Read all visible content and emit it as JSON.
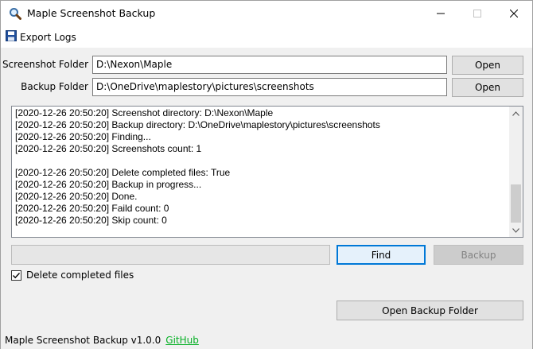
{
  "window": {
    "title": "Maple Screenshot Backup",
    "minimize_glyph": "—",
    "maximize_glyph": "☐",
    "close_glyph": "✕"
  },
  "menu": {
    "export_logs": "Export Logs"
  },
  "fields": {
    "screenshot_folder": {
      "label": "Screenshot Folder",
      "value": "D:\\Nexon\\Maple",
      "button": "Open"
    },
    "backup_folder": {
      "label": "Backup Folder",
      "value": "D:\\OneDrive\\maplestory\\pictures\\screenshots",
      "button": "Open"
    }
  },
  "log": {
    "lines": [
      "[2020-12-26 20:50:20] Screenshot directory: D:\\Nexon\\Maple",
      "[2020-12-26 20:50:20] Backup directory: D:\\OneDrive\\maplestory\\pictures\\screenshots",
      "[2020-12-26 20:50:20] Finding...",
      "[2020-12-26 20:50:20] Screenshots count: 1",
      "",
      "[2020-12-26 20:50:20] Delete completed files: True",
      "[2020-12-26 20:50:20] Backup in progress...",
      "[2020-12-26 20:50:20] Done.",
      "[2020-12-26 20:50:20] Faild count: 0",
      "[2020-12-26 20:50:20] Skip count: 0"
    ]
  },
  "progress": {
    "fraction": 0
  },
  "actions": {
    "find": "Find",
    "backup": "Backup",
    "delete_completed_label": "Delete completed files",
    "delete_completed_checked": true,
    "open_backup_folder": "Open Backup Folder"
  },
  "status": {
    "version": "Maple Screenshot Backup v1.0.0",
    "link": "GitHub"
  },
  "icons": {
    "app": "magnifier-icon",
    "export": "floppy-disk-icon"
  }
}
